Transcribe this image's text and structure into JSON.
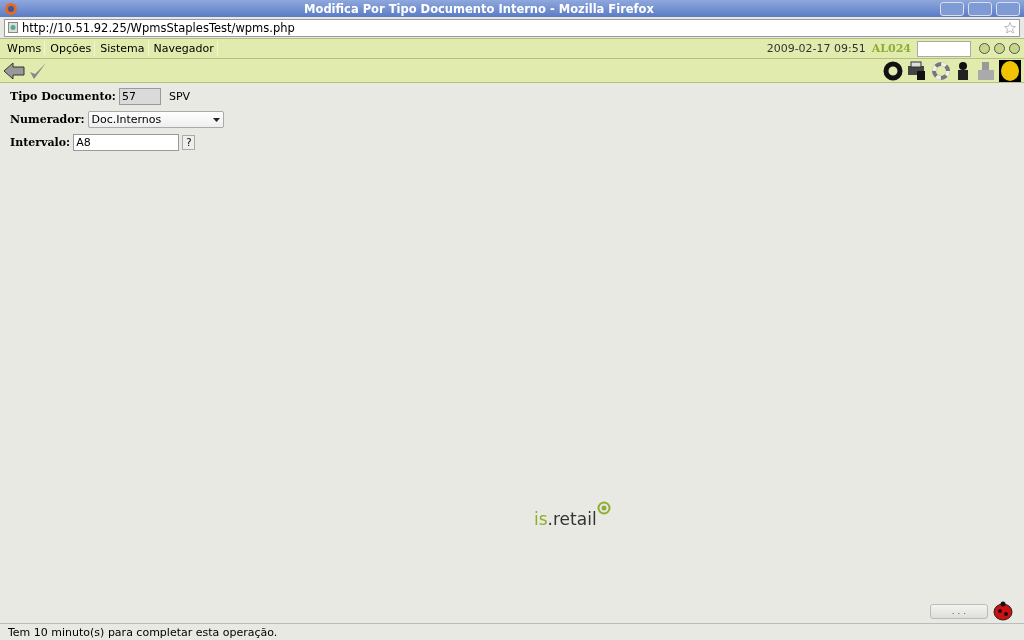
{
  "window": {
    "title": "Modifica Por Tipo Documento Interno - Mozilla Firefox"
  },
  "address_bar": {
    "url": "http://10.51.92.25/WpmsStaplesTest/wpms.php"
  },
  "menu": [
    "Wpms",
    "Opções",
    "Sistema",
    "Navegador"
  ],
  "header": {
    "datetime": "2009-02-17 09:51",
    "user": "AL024"
  },
  "form": [
    {
      "kind": "readonly",
      "label": "Tipo Documento:",
      "value": "57",
      "suffix": "SPV"
    },
    {
      "kind": "select",
      "label": "Numerador:",
      "value": "Doc.Internos"
    },
    {
      "kind": "lookup",
      "label": "Intervalo:",
      "value": "A8",
      "button": "?"
    }
  ],
  "logo": {
    "prefix": "is",
    "suffix": ".retail"
  },
  "more_button": ". . .",
  "status_bar": "Tem 10 minuto(s) para completar esta operação."
}
